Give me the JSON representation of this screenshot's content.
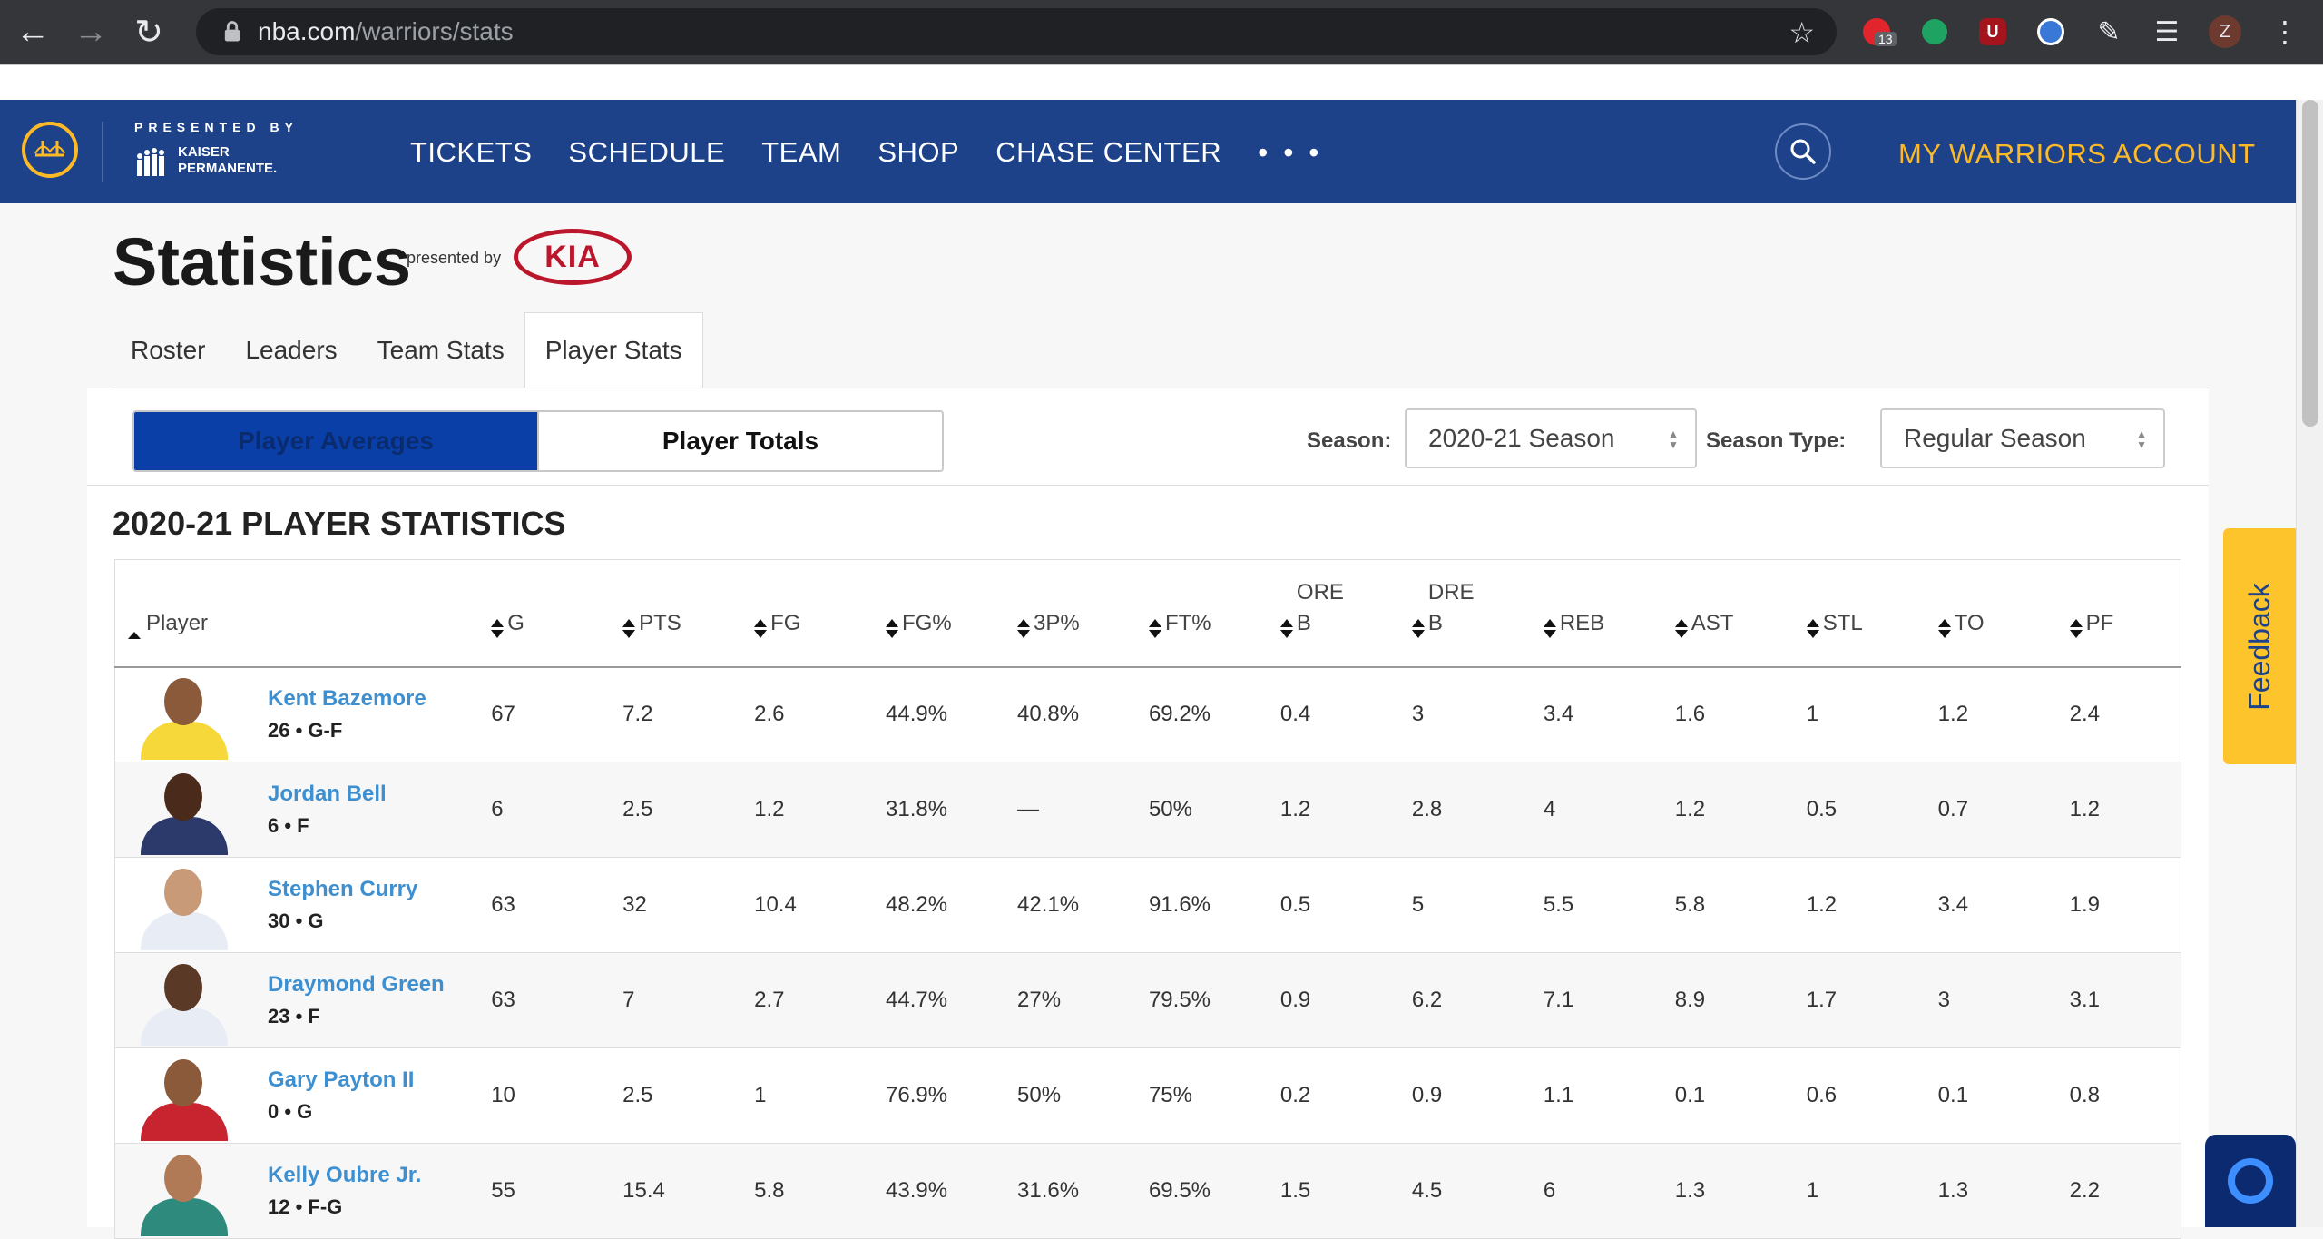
{
  "browser": {
    "url_host": "nba.com",
    "url_path": "/warriors/stats",
    "ext_badge_count": "13",
    "profile_initial": "Z"
  },
  "header": {
    "presented_by": "PRESENTED BY",
    "sponsor_line1": "KAISER",
    "sponsor_line2": "PERMANENTE.",
    "nav": [
      "TICKETS",
      "SCHEDULE",
      "TEAM",
      "SHOP",
      "CHASE CENTER",
      "• • •"
    ],
    "account_label": "MY WARRIORS ACCOUNT"
  },
  "page": {
    "title": "Statistics",
    "presented_by": "presented by",
    "sponsor_logo_text": "KIA",
    "tabs": [
      "Roster",
      "Leaders",
      "Team Stats",
      "Player Stats"
    ],
    "active_tab": "Player Stats",
    "toggle": {
      "averages": "Player Averages",
      "totals": "Player Totals"
    },
    "season_label": "Season:",
    "season_value": "2020-21 Season",
    "season_type_label": "Season Type:",
    "season_type_value": "Regular Season",
    "section_title": "2020-21 PLAYER STATISTICS"
  },
  "table": {
    "columns": [
      "Player",
      "G",
      "PTS",
      "FG",
      "FG%",
      "3P%",
      "FT%",
      "ORE B",
      "DRE B",
      "REB",
      "AST",
      "STL",
      "TO",
      "PF"
    ],
    "rows": [
      {
        "name": "Kent Bazemore",
        "meta": "26 • G-F",
        "stats": [
          "67",
          "7.2",
          "2.6",
          "44.9%",
          "40.8%",
          "69.2%",
          "0.4",
          "3",
          "3.4",
          "1.6",
          "1",
          "1.2",
          "2.4"
        ]
      },
      {
        "name": "Jordan Bell",
        "meta": "6 • F",
        "stats": [
          "6",
          "2.5",
          "1.2",
          "31.8%",
          "—",
          "50%",
          "1.2",
          "2.8",
          "4",
          "1.2",
          "0.5",
          "0.7",
          "1.2"
        ]
      },
      {
        "name": "Stephen Curry",
        "meta": "30 • G",
        "stats": [
          "63",
          "32",
          "10.4",
          "48.2%",
          "42.1%",
          "91.6%",
          "0.5",
          "5",
          "5.5",
          "5.8",
          "1.2",
          "3.4",
          "1.9"
        ]
      },
      {
        "name": "Draymond Green",
        "meta": "23 • F",
        "stats": [
          "63",
          "7",
          "2.7",
          "44.7%",
          "27%",
          "79.5%",
          "0.9",
          "6.2",
          "7.1",
          "8.9",
          "1.7",
          "3",
          "3.1"
        ]
      },
      {
        "name": "Gary Payton II",
        "meta": "0 • G",
        "stats": [
          "10",
          "2.5",
          "1",
          "76.9%",
          "50%",
          "75%",
          "0.2",
          "0.9",
          "1.1",
          "0.1",
          "0.6",
          "0.1",
          "0.8"
        ]
      },
      {
        "name": "Kelly Oubre Jr.",
        "meta": "12 • F-G",
        "stats": [
          "55",
          "15.4",
          "5.8",
          "43.9%",
          "31.6%",
          "69.5%",
          "1.5",
          "4.5",
          "6",
          "1.3",
          "1",
          "1.3",
          "2.2"
        ]
      }
    ]
  },
  "widgets": {
    "feedback": "Feedback"
  },
  "colors": {
    "brand_blue": "#1d428a",
    "brand_gold": "#fdb927",
    "link_blue": "#3d8fd0",
    "kia_red": "#bb162b"
  }
}
